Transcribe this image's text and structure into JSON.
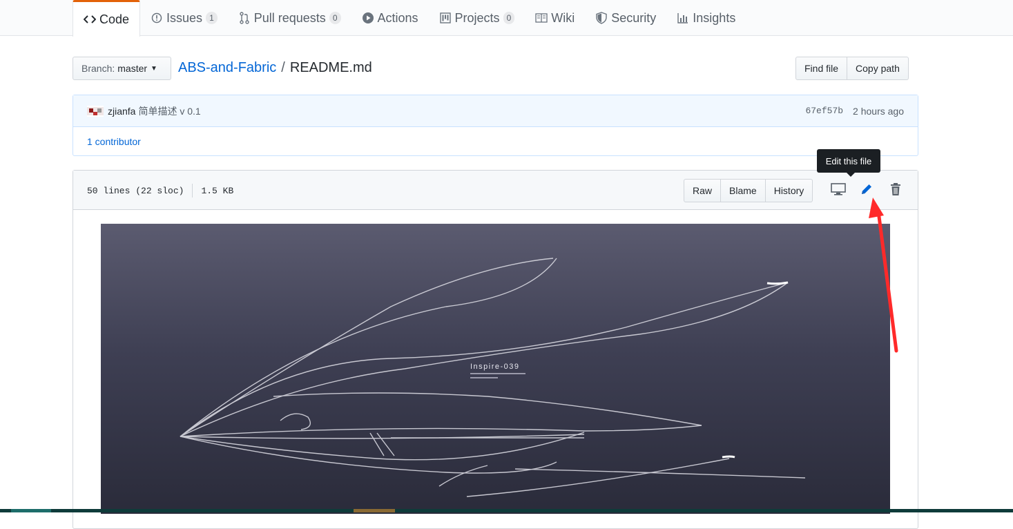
{
  "nav": {
    "tabs": [
      {
        "label": "Code",
        "icon": "code-icon",
        "selected": true
      },
      {
        "label": "Issues",
        "icon": "issue-icon",
        "count": "1"
      },
      {
        "label": "Pull requests",
        "icon": "pull-request-icon",
        "count": "0"
      },
      {
        "label": "Actions",
        "icon": "play-icon"
      },
      {
        "label": "Projects",
        "icon": "project-icon",
        "count": "0"
      },
      {
        "label": "Wiki",
        "icon": "book-icon"
      },
      {
        "label": "Security",
        "icon": "shield-icon"
      },
      {
        "label": "Insights",
        "icon": "graph-icon"
      }
    ]
  },
  "breadcrumb": {
    "branch_label": "Branch:",
    "branch": "master",
    "repo": "ABS-and-Fabric",
    "separator": "/",
    "file": "README.md",
    "find_file": "Find file",
    "copy_path": "Copy path"
  },
  "commit": {
    "author": "zjianfa",
    "message": "简单描述 v 0.1",
    "sha": "67ef57b",
    "time": "2 hours ago",
    "contributors": "1 contributor"
  },
  "file": {
    "lines": "50 lines (22 sloc)",
    "size": "1.5 KB",
    "raw": "Raw",
    "blame": "Blame",
    "history": "History",
    "tooltip": "Edit this file"
  },
  "readme_image": {
    "title": "Inspire-039"
  },
  "colors": {
    "accent_tab": "#e36209",
    "link": "#0366d6",
    "annotation_arrow": "#ff2a2a"
  }
}
